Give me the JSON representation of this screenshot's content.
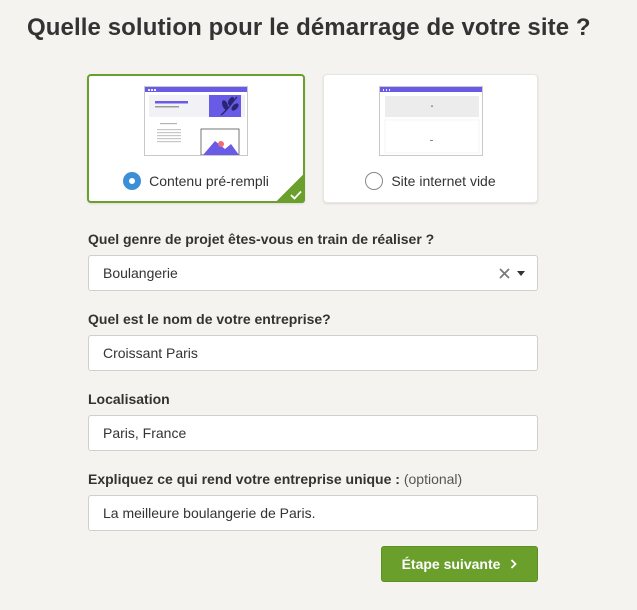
{
  "page": {
    "title": "Quelle solution pour le démarrage de votre site ?"
  },
  "options": {
    "prefilled": {
      "label": "Contenu pré-rempli",
      "selected": true
    },
    "empty": {
      "label": "Site internet vide",
      "selected": false
    }
  },
  "form": {
    "project_type": {
      "label": "Quel genre de projet êtes-vous en train de réaliser ?",
      "value": "Boulangerie"
    },
    "company_name": {
      "label": "Quel est le nom de votre entreprise?",
      "value": "Croissant Paris"
    },
    "location": {
      "label": "Localisation",
      "value": "Paris, France"
    },
    "unique": {
      "label": "Expliquez ce qui rend votre entreprise unique :",
      "optional_label": "(optional)",
      "value": "La meilleure boulangerie de Paris."
    }
  },
  "actions": {
    "next_label": "Étape suivante"
  },
  "colors": {
    "accent_green": "#6a9f2c",
    "radio_blue": "#3c8fd6",
    "preview_purple": "#6a5be6",
    "background": "#f4f3ef"
  },
  "icons": {
    "selected_check": "check-icon",
    "clear": "clear-x-icon",
    "dropdown": "caret-down-icon",
    "next": "chevron-right-icon"
  }
}
